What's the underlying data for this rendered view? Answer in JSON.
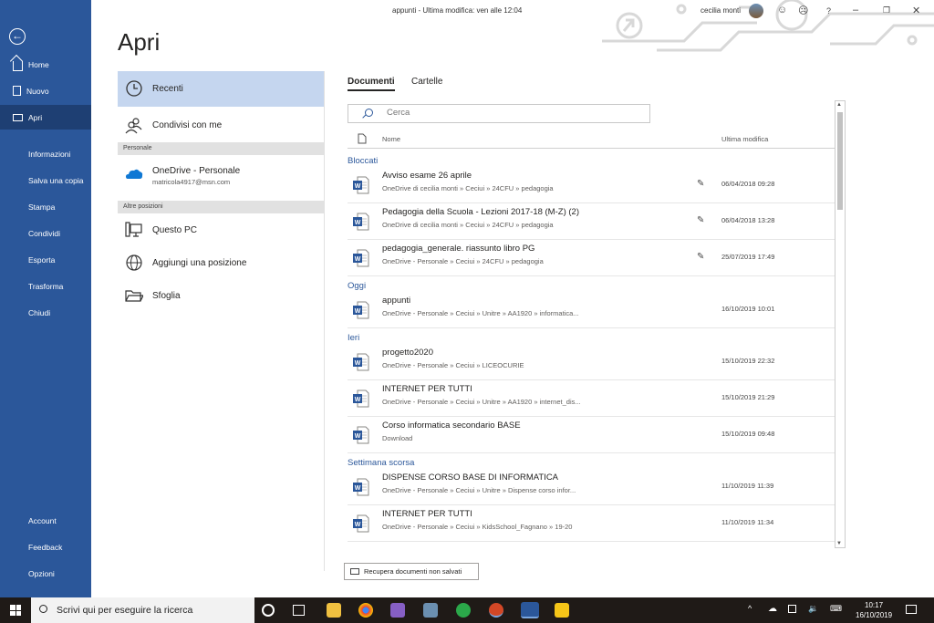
{
  "window": {
    "title": "appunti - Ultima modifica: ven alle 12:04",
    "user": "cecilia monti"
  },
  "nav": {
    "back": "←",
    "items": [
      {
        "label": "Home"
      },
      {
        "label": "Nuovo"
      },
      {
        "label": "Apri"
      },
      {
        "label": "Informazioni"
      },
      {
        "label": "Salva una copia"
      },
      {
        "label": "Stampa"
      },
      {
        "label": "Condividi"
      },
      {
        "label": "Esporta"
      },
      {
        "label": "Trasforma"
      },
      {
        "label": "Chiudi"
      },
      {
        "label": "Account"
      },
      {
        "label": "Feedback"
      },
      {
        "label": "Opzioni"
      }
    ],
    "active": "Apri"
  },
  "heading": "Apri",
  "places": {
    "recenti": "Recenti",
    "condivisi": "Condivisi con me",
    "section_personale": "Personale",
    "onedrive": "OneDrive - Personale",
    "onedrive_email": "matricola4917@msn.com",
    "section_altre": "Altre posizioni",
    "questo_pc": "Questo PC",
    "aggiungi": "Aggiungi una posizione",
    "sfoglia": "Sfoglia"
  },
  "tabs": {
    "documenti": "Documenti",
    "cartelle": "Cartelle"
  },
  "search": {
    "placeholder": "Cerca"
  },
  "columns": {
    "name": "Nome",
    "modified": "Ultima modifica"
  },
  "groups": {
    "bloccati": "Bloccati",
    "oggi": "Oggi",
    "ieri": "Ieri",
    "settimana": "Settimana scorsa"
  },
  "files": [
    {
      "name": "Avviso esame 26 aprile",
      "path": "OneDrive di cecilia monti » Ceciui » 24CFU » pedagogia",
      "date": "06/04/2018 09:28",
      "pinned": true
    },
    {
      "name": "Pedagogia della Scuola - Lezioni 2017-18 (M-Z) (2)",
      "path": "OneDrive di cecilia monti » Ceciui » 24CFU » pedagogia",
      "date": "06/04/2018 13:28",
      "pinned": true
    },
    {
      "name": "pedagogia_generale. riassunto libro PG",
      "path": "OneDrive - Personale » Ceciui » 24CFU » pedagogia",
      "date": "25/07/2019 17:49",
      "pinned": true
    },
    {
      "name": "appunti",
      "path": "OneDrive - Personale » Ceciui » Unitre » AA1920 » informatica...",
      "date": "16/10/2019 10:01",
      "pinned": false
    },
    {
      "name": "progetto2020",
      "path": "OneDrive - Personale » Ceciui » LICEOCURIE",
      "date": "15/10/2019 22:32",
      "pinned": false
    },
    {
      "name": "INTERNET PER TUTTI",
      "path": "OneDrive - Personale » Ceciui » Unitre » AA1920 » internet_dis...",
      "date": "15/10/2019 21:29",
      "pinned": false
    },
    {
      "name": "Corso informatica secondario BASE",
      "path": "Download",
      "date": "15/10/2019 09:48",
      "pinned": false
    },
    {
      "name": "DISPENSE CORSO BASE DI INFORMATICA",
      "path": "OneDrive - Personale » Ceciui » Unitre » Dispense corso infor...",
      "date": "11/10/2019 11:39",
      "pinned": false
    },
    {
      "name": "INTERNET PER TUTTI",
      "path": "OneDrive - Personale » Ceciui » KidsSchool_Fagnano » 19-20",
      "date": "11/10/2019 11:34",
      "pinned": false
    }
  ],
  "recover_button": "Recupera documenti non salvati",
  "taskbar": {
    "search_placeholder": "Scrivi qui per eseguire la ricerca",
    "time": "10:17",
    "date": "16/10/2019"
  },
  "colors": {
    "accent": "#2b579a",
    "nav_active": "#1e3f73",
    "selected_place": "#c5d6ef",
    "taskbar": "#1f1a17"
  }
}
